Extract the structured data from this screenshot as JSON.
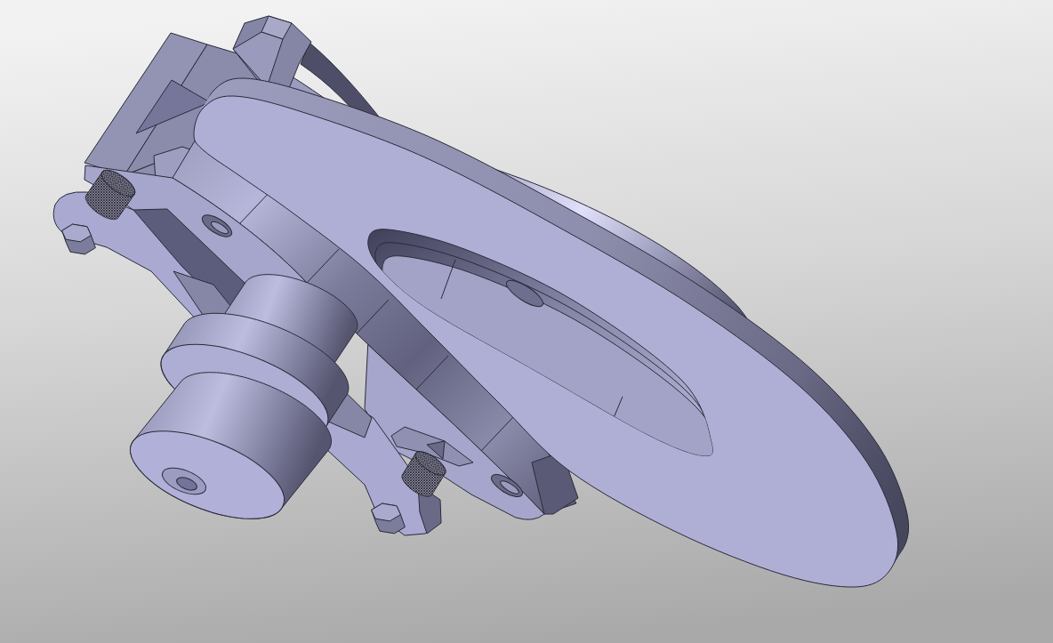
{
  "viewport": {
    "kind": "cad-model"
  }
}
